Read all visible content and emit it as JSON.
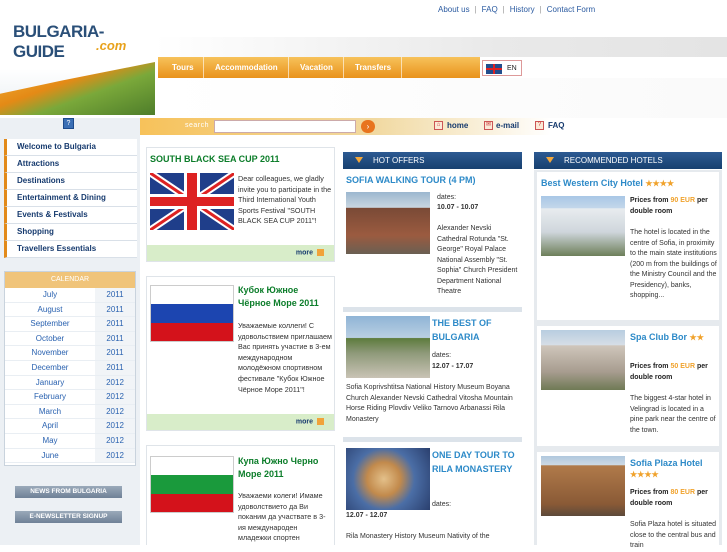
{
  "logo": {
    "text": "BULGARIA-GUIDE",
    "sub": ".com"
  },
  "top_links": [
    "About us",
    "FAQ",
    "History",
    "Contact Form"
  ],
  "nav": [
    "Tours",
    "Accommodation",
    "Vacation",
    "Transfers"
  ],
  "lang": "EN",
  "search": {
    "label": "search",
    "go": "›"
  },
  "quick_links": [
    {
      "label": "home",
      "icon": "home-icon"
    },
    {
      "label": "e-mail",
      "icon": "mail-icon"
    },
    {
      "label": "FAQ",
      "icon": "question-icon"
    }
  ],
  "left_icon": "?",
  "menu": [
    "Welcome to Bulgaria",
    "Attractions",
    "Destinations",
    "Entertainment & Dining",
    "Events & Festivals",
    "Shopping",
    "Travellers Essentials"
  ],
  "calendar": {
    "title": "CALENDAR",
    "rows": [
      {
        "m": "July",
        "y": "2011"
      },
      {
        "m": "August",
        "y": "2011"
      },
      {
        "m": "September",
        "y": "2011"
      },
      {
        "m": "October",
        "y": "2011"
      },
      {
        "m": "November",
        "y": "2011"
      },
      {
        "m": "December",
        "y": "2011"
      },
      {
        "m": "January",
        "y": "2012"
      },
      {
        "m": "February",
        "y": "2012"
      },
      {
        "m": "March",
        "y": "2012"
      },
      {
        "m": "April",
        "y": "2012"
      },
      {
        "m": "May",
        "y": "2012"
      },
      {
        "m": "June",
        "y": "2012"
      }
    ]
  },
  "left_buttons": [
    "NEWS FROM BULGARIA",
    "E-NEWSLETTER SIGNUP"
  ],
  "news": [
    {
      "title": "SOUTH BLACK SEA CUP 2011",
      "text": "Dear colleagues, we gladly invite you to participate in the Third International Youth Sports Festival \"SOUTH BLACK SEA CUP 2011\"!",
      "more": "more"
    },
    {
      "title": "Кубок Южное Чёрное Море 2011",
      "text": "Уважаемые коллеги! С удовольствием приглашаем Вас принять участие в 3-ем международном молодёжном спортивном фестивале \"Кубок Южное Чёрное Море 2011\"!",
      "more": "more"
    },
    {
      "title": "Купа Южно Черно Море 2011",
      "text": "Уважаеми колеги! Имаме удоволствието да Ви поканим да участвате в 3-ия международен младежки спортен"
    }
  ],
  "hot_offers": {
    "header": "HOT OFFERS",
    "items": [
      {
        "title": "SOFIA WALKING TOUR (4 PM)",
        "dates_label": "dates:",
        "dates": "10.07 - 10.07",
        "text": "Alexander Nevski Cathedral Rotunda \"St. George\" Royal Palace National Assembly \"St. Sophia\" Church President Department National Theatre"
      },
      {
        "title": "THE BEST OF BULGARIA",
        "dates_label": "dates:",
        "dates": "12.07 - 17.07",
        "text": "Sofia Koprivshtitsa National History Museum Boyana Church Alexander Nevski Cathedral Vitosha Mountain Horse Riding Plovdiv Veliko Tarnovo Arbanassi Rila Monastery"
      },
      {
        "title": "ONE DAY TOUR TO RILA MONASTERY",
        "dates_label": "dates:",
        "dates": "12.07 - 12.07",
        "text": "Rila Monastery History Museum Nativity of the"
      }
    ]
  },
  "hotels": {
    "header": "RECOMMENDED HOTELS",
    "items": [
      {
        "name": "Best Western City Hotel",
        "stars": "★★★★",
        "price_pre": "Prices from",
        "price": "90 EUR",
        "price_post": "per double room",
        "text": "The hotel is located in the centre of Sofia, in proximity to the main state institutions (200 m from the buildings of the Ministry Council and the Presidency), banks, shopping..."
      },
      {
        "name": "Spa Club Bor",
        "stars": "★★",
        "price_pre": "Prices from",
        "price": "50 EUR",
        "price_post": "per double room",
        "text": "The biggest 4-star hotel in Velingrad is located in a pine park near the centre of the town."
      },
      {
        "name": "Sofia Plaza Hotel",
        "stars": "★★★★",
        "price_pre": "Prices from",
        "price": "80 EUR",
        "price_post": "per double room",
        "text": "Sofia Plaza hotel is situated close to the central bus and train"
      }
    ]
  }
}
